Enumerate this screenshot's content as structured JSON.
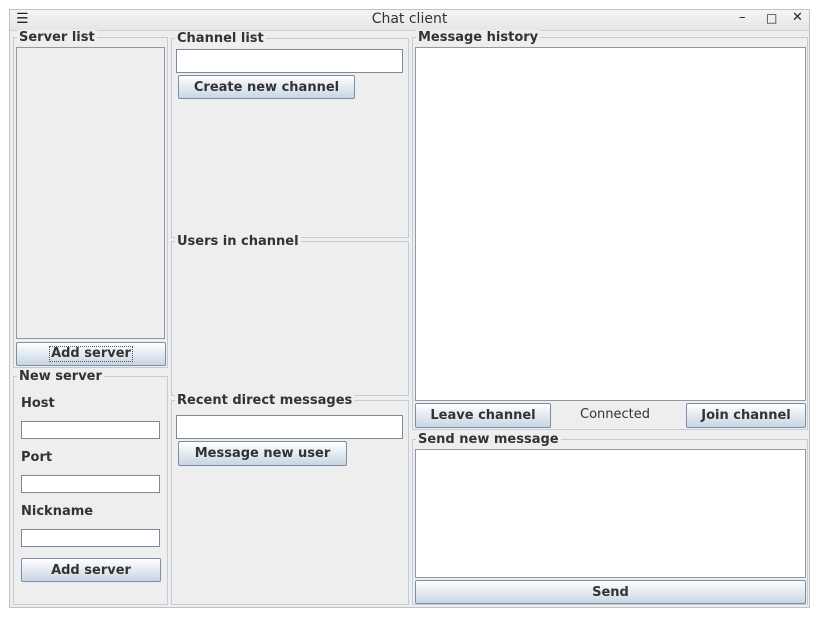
{
  "window": {
    "title": "Chat client",
    "menu_icon": "hamburger-menu-icon",
    "minimize_icon": "minimize-icon",
    "maximize_icon": "maximize-icon",
    "close_icon": "close-icon"
  },
  "server_list": {
    "title": "Server list",
    "items": [],
    "add_button": "Add server"
  },
  "new_server": {
    "title": "New server",
    "host_label": "Host",
    "host_value": "",
    "port_label": "Port",
    "port_value": "",
    "nickname_label": "Nickname",
    "nickname_value": "",
    "add_button": "Add server"
  },
  "channel_list": {
    "title": "Channel list",
    "input_value": "",
    "create_button": "Create new channel",
    "items": []
  },
  "users_in_channel": {
    "title": "Users in channel",
    "items": []
  },
  "recent_dms": {
    "title": "Recent direct messages",
    "input_value": "",
    "message_button": "Message new user",
    "items": []
  },
  "message_history": {
    "title": "Message history",
    "messages": [],
    "leave_button": "Leave channel",
    "status": "Connected",
    "join_button": "Join channel"
  },
  "send_message": {
    "title": "Send new message",
    "text_value": "",
    "send_button": "Send"
  }
}
